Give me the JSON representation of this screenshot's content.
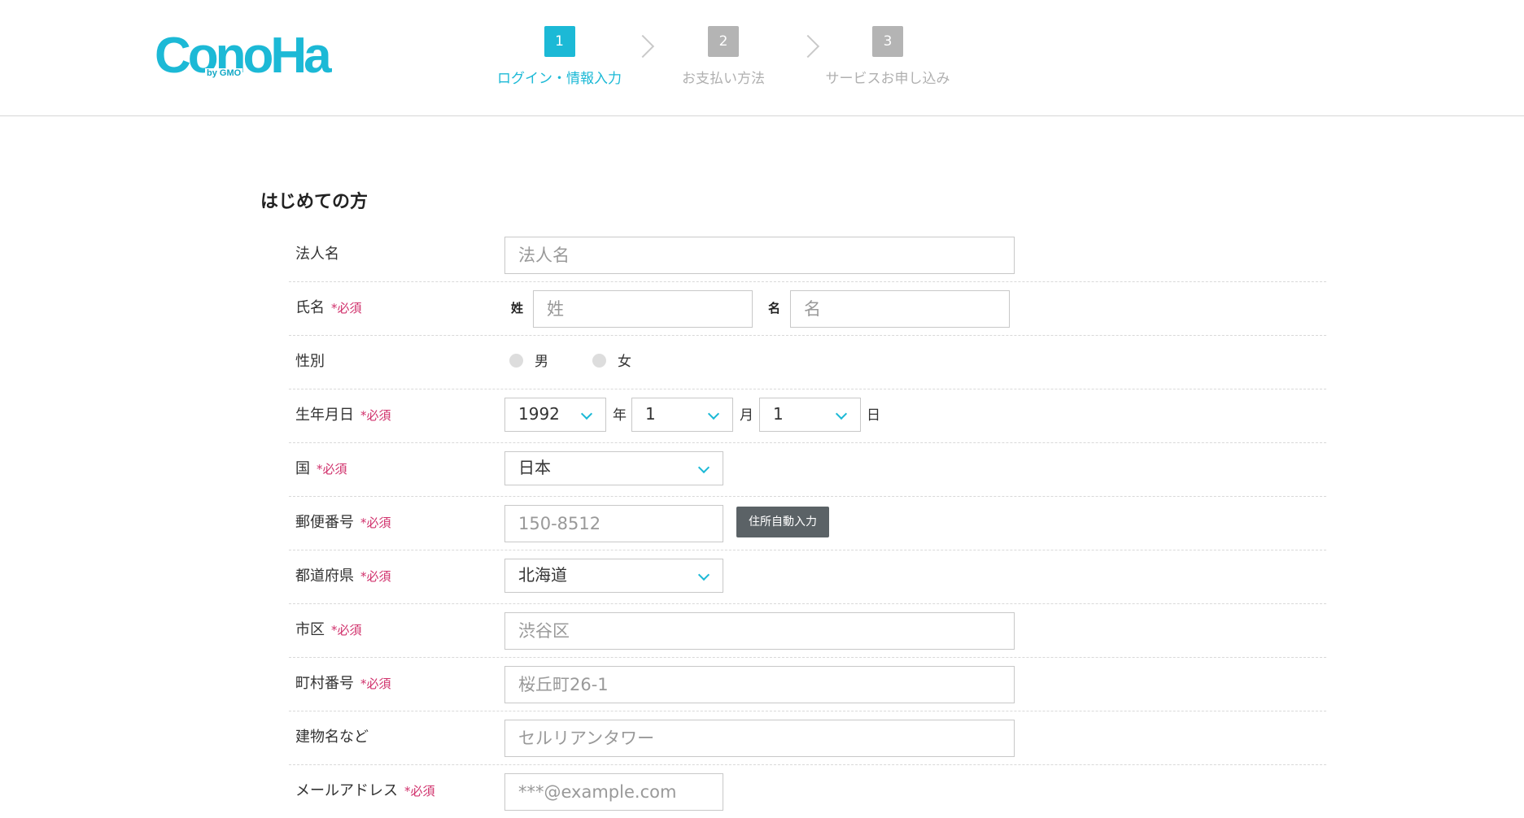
{
  "header": {
    "logo_text": "ConoHa",
    "logo_sub": "by GMO",
    "steps": [
      {
        "num": "1",
        "label": "ログイン・情報入力"
      },
      {
        "num": "2",
        "label": "お支払い方法"
      },
      {
        "num": "3",
        "label": "サービスお申し込み"
      }
    ]
  },
  "form": {
    "title": "はじめての方",
    "required_mark": "*必須",
    "company": {
      "label": "法人名",
      "placeholder": "法人名"
    },
    "name": {
      "label": "氏名",
      "last_label": "姓",
      "last_placeholder": "姓",
      "first_label": "名",
      "first_placeholder": "名"
    },
    "gender": {
      "label": "性別",
      "options": [
        "男",
        "女"
      ]
    },
    "birthday": {
      "label": "生年月日",
      "year": "1992",
      "year_unit": "年",
      "month": "1",
      "month_unit": "月",
      "day": "1",
      "day_unit": "日"
    },
    "country": {
      "label": "国",
      "value": "日本"
    },
    "postal": {
      "label": "郵便番号",
      "placeholder": "150-8512",
      "button": "住所自動入力"
    },
    "prefecture": {
      "label": "都道府県",
      "value": "北海道"
    },
    "city": {
      "label": "市区",
      "placeholder": "渋谷区"
    },
    "street": {
      "label": "町村番号",
      "placeholder": "桜丘町26-1"
    },
    "building": {
      "label": "建物名など",
      "placeholder": "セルリアンタワー"
    },
    "email": {
      "label": "メールアドレス",
      "placeholder": "***@example.com"
    }
  }
}
